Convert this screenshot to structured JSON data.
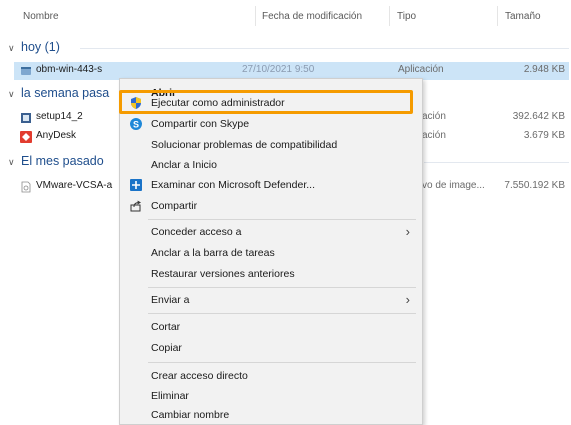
{
  "columns": {
    "name": "Nombre",
    "modified": "Fecha de modificación",
    "type": "Tipo",
    "size": "Tamaño"
  },
  "groups": {
    "today": "hoy (1)",
    "this_week": "la semana pasa",
    "last_month": "El mes pasado"
  },
  "files": [
    {
      "name": "obm-win-443-s",
      "date": "27/10/2021 9:50",
      "type": "Aplicación",
      "size": "2.948 KB"
    },
    {
      "name": "setup14_2",
      "type": "ación",
      "size": "392.642 KB"
    },
    {
      "name": "AnyDesk",
      "type": "ación",
      "size": "3.679 KB"
    },
    {
      "name": "VMware-VCSA-a",
      "type": "vo de image...",
      "size": "7.550.192 KB"
    }
  ],
  "menu": {
    "open": "Abrir",
    "run_as_admin": "Ejecutar como administrador",
    "share_skype": "Compartir con Skype",
    "troubleshoot": "Solucionar problemas de compatibilidad",
    "pin_start": "Anclar a Inicio",
    "defender": "Examinar con Microsoft Defender...",
    "share": "Compartir",
    "grant_access": "Conceder acceso a",
    "pin_taskbar": "Anclar a la barra de tareas",
    "restore_versions": "Restaurar versiones anteriores",
    "send_to": "Enviar a",
    "cut": "Cortar",
    "copy": "Copiar",
    "create_shortcut": "Crear acceso directo",
    "delete": "Eliminar",
    "rename": "Cambiar nombre"
  },
  "icons": {
    "uac_shield": "uac-shield-icon",
    "skype": "skype-icon",
    "defender": "defender-icon",
    "share": "share-icon"
  },
  "colors": {
    "highlight": "#f59b00",
    "selection": "#cce4f7",
    "group_text": "#1f4e8c"
  }
}
